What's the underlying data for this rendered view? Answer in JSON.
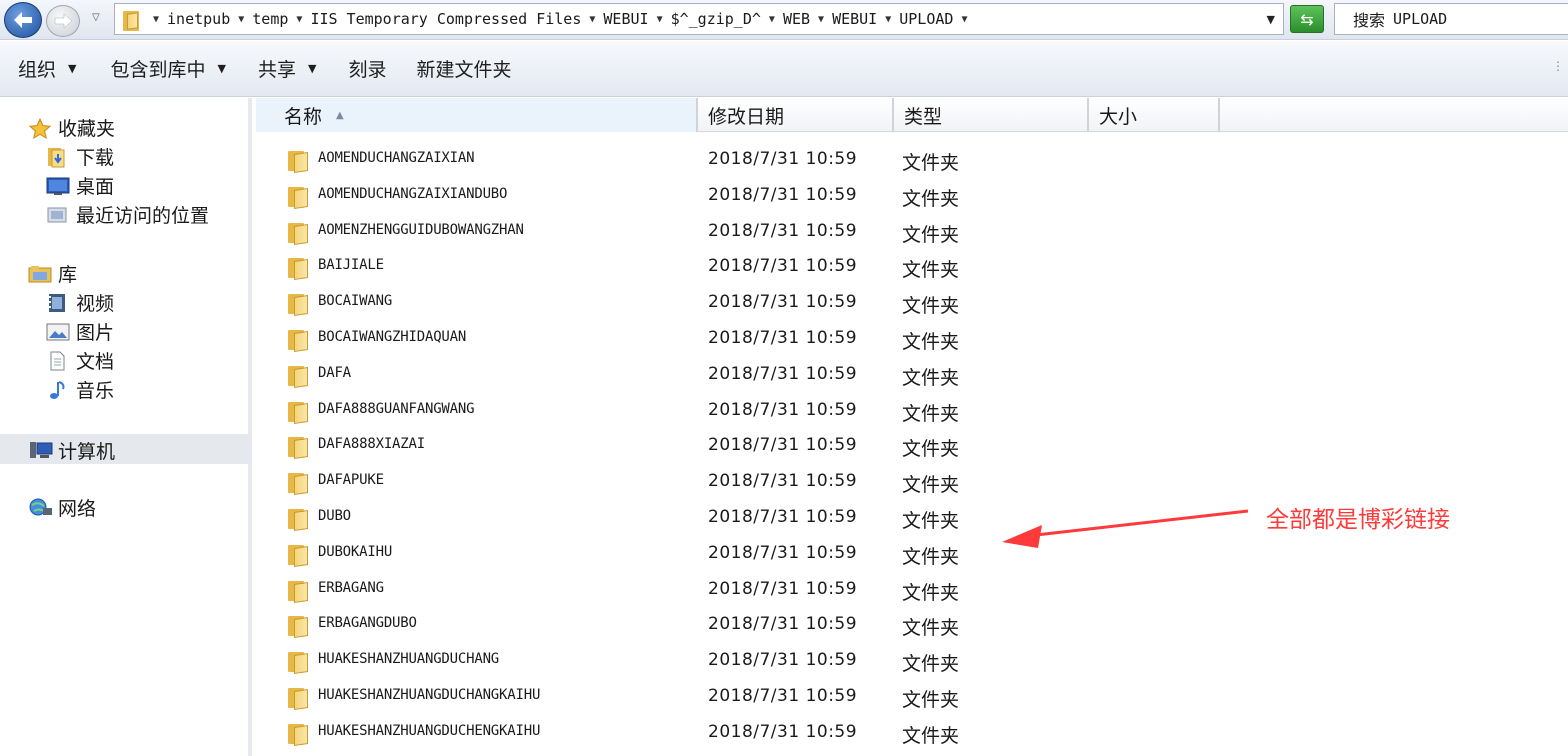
{
  "address": {
    "crumbs": [
      "inetpub",
      "temp",
      "IIS Temporary Compressed Files",
      "WEBUI",
      "$^_gzip_D^",
      "WEB",
      "WEBUI",
      "UPLOAD"
    ]
  },
  "search": {
    "label": "搜索",
    "term": "UPLOAD"
  },
  "toolbar": {
    "organize": "组织",
    "include_library": "包含到库中",
    "share": "共享",
    "burn": "刻录",
    "new_folder": "新建文件夹"
  },
  "nav": {
    "favorites": "收藏夹",
    "downloads": "下载",
    "desktop": "桌面",
    "recent": "最近访问的位置",
    "libraries": "库",
    "videos": "视频",
    "pictures": "图片",
    "documents": "文档",
    "music": "音乐",
    "computer": "计算机",
    "network": "网络"
  },
  "columns": {
    "name": "名称",
    "modified": "修改日期",
    "type": "类型",
    "size": "大小"
  },
  "files": [
    {
      "name": "AOMENDUCHANGZAIXIAN",
      "date": "2018/7/31 10:59",
      "type": "文件夹"
    },
    {
      "name": "AOMENDUCHANGZAIXIANDUBO",
      "date": "2018/7/31 10:59",
      "type": "文件夹"
    },
    {
      "name": "AOMENZHENGGUIDUBOWANGZHAN",
      "date": "2018/7/31 10:59",
      "type": "文件夹"
    },
    {
      "name": "BAIJIALE",
      "date": "2018/7/31 10:59",
      "type": "文件夹"
    },
    {
      "name": "BOCAIWANG",
      "date": "2018/7/31 10:59",
      "type": "文件夹"
    },
    {
      "name": "BOCAIWANGZHIDAQUAN",
      "date": "2018/7/31 10:59",
      "type": "文件夹"
    },
    {
      "name": "DAFA",
      "date": "2018/7/31 10:59",
      "type": "文件夹"
    },
    {
      "name": "DAFA888GUANFANGWANG",
      "date": "2018/7/31 10:59",
      "type": "文件夹"
    },
    {
      "name": "DAFA888XIAZAI",
      "date": "2018/7/31 10:59",
      "type": "文件夹"
    },
    {
      "name": "DAFAPUKE",
      "date": "2018/7/31 10:59",
      "type": "文件夹"
    },
    {
      "name": "DUBO",
      "date": "2018/7/31 10:59",
      "type": "文件夹"
    },
    {
      "name": "DUBOKAIHU",
      "date": "2018/7/31 10:59",
      "type": "文件夹"
    },
    {
      "name": "ERBAGANG",
      "date": "2018/7/31 10:59",
      "type": "文件夹"
    },
    {
      "name": "ERBAGANGDUBO",
      "date": "2018/7/31 10:59",
      "type": "文件夹"
    },
    {
      "name": "HUAKESHANZHUANGDUCHANG",
      "date": "2018/7/31 10:59",
      "type": "文件夹"
    },
    {
      "name": "HUAKESHANZHUANGDUCHANGKAIHU",
      "date": "2018/7/31 10:59",
      "type": "文件夹"
    },
    {
      "name": "HUAKESHANZHUANGDUCHENGKAIHU",
      "date": "2018/7/31 10:59",
      "type": "文件夹"
    }
  ],
  "annotation": {
    "text": "全部都是博彩链接",
    "color": "#ff3a3a"
  },
  "icons": {
    "back": "back-arrow-icon",
    "forward": "forward-arrow-icon",
    "refresh": "refresh-icon",
    "folder": "folder-icon"
  }
}
